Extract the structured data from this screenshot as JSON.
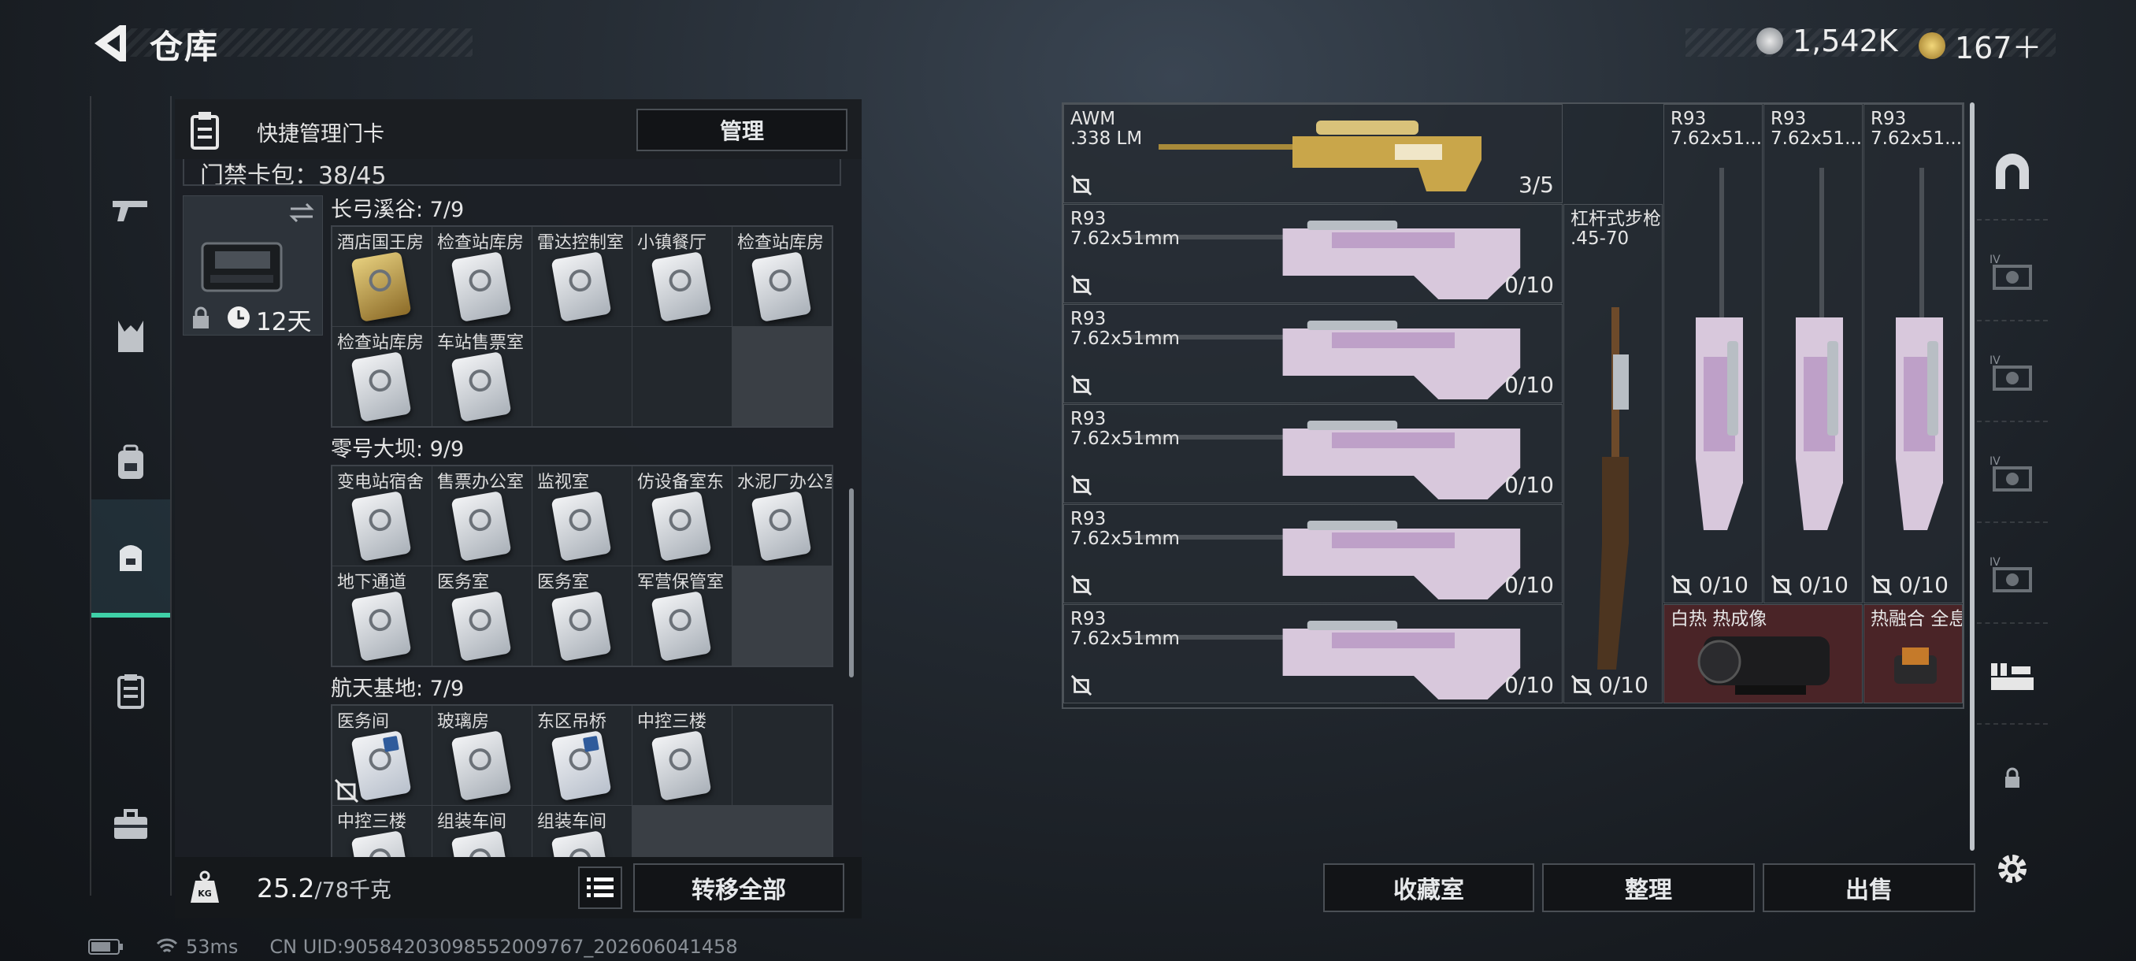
{
  "header": {
    "title": "仓库",
    "currency1": "1,542K",
    "currency2": "167＋"
  },
  "left_nav": [
    {
      "icon": "rifle-icon"
    },
    {
      "icon": "armor-icon"
    },
    {
      "icon": "backpack-icon"
    },
    {
      "icon": "bag-icon"
    },
    {
      "icon": "card-case-icon"
    },
    {
      "icon": "toolbox-icon"
    }
  ],
  "manager": {
    "title": "快捷管理门卡",
    "button": "管理",
    "pack_label": "门禁卡包：38/45",
    "bag_days": "12天"
  },
  "sections": [
    {
      "title": "长弓溪谷: 7/9",
      "cells": [
        {
          "label": "酒店国王房",
          "color": "red",
          "card": "gold"
        },
        {
          "label": "检查站库房",
          "color": "grey",
          "card": "white"
        },
        {
          "label": "雷达控制室",
          "color": "brown",
          "card": "white"
        },
        {
          "label": "小镇餐厅",
          "color": "purple",
          "card": "white"
        },
        {
          "label": "检查站库房",
          "color": "blue",
          "card": "white"
        },
        {
          "label": "检查站库房",
          "color": "grey",
          "card": "white"
        },
        {
          "label": "车站售票室",
          "color": "grey",
          "card": "white"
        },
        {
          "label": "",
          "color": "dark",
          "card": ""
        },
        {
          "label": "",
          "color": "dark",
          "card": ""
        }
      ]
    },
    {
      "title": "零号大坝: 9/9",
      "cells": [
        {
          "label": "变电站宿舍",
          "color": "grey",
          "card": "white"
        },
        {
          "label": "售票办公室",
          "color": "grey",
          "card": "white"
        },
        {
          "label": "监视室",
          "color": "brown",
          "card": "white"
        },
        {
          "label": "仿设备室东",
          "color": "brown",
          "card": "white"
        },
        {
          "label": "水泥厂办公室",
          "color": "purple",
          "card": "white"
        },
        {
          "label": "地下通道",
          "color": "blue",
          "card": "white"
        },
        {
          "label": "医务室",
          "color": "grey",
          "card": "white"
        },
        {
          "label": "医务室",
          "color": "grey",
          "card": "white"
        },
        {
          "label": "军营保管室",
          "color": "grey",
          "card": "white"
        }
      ]
    },
    {
      "title": "航天基地: 7/9",
      "cells": [
        {
          "label": "医务间",
          "color": "purple",
          "card": "blue"
        },
        {
          "label": "玻璃房",
          "color": "purple",
          "card": "white"
        },
        {
          "label": "东区吊桥",
          "color": "brown",
          "card": "blue"
        },
        {
          "label": "中控三楼",
          "color": "purple",
          "card": "white"
        },
        {
          "label": "",
          "color": "dark",
          "card": ""
        },
        {
          "label": "中控三楼",
          "color": "grey",
          "card": "white"
        },
        {
          "label": "组装车间",
          "color": "grey",
          "card": "white"
        },
        {
          "label": "组装车间",
          "color": "grey",
          "card": "white"
        }
      ]
    }
  ],
  "weight": {
    "current": "25.2",
    "max": "/78千克",
    "transfer": "转移全部"
  },
  "status": {
    "ping": "53ms",
    "uid": "CN UID:9058420309855200​9767_202606041458"
  },
  "weapons": [
    {
      "name": "AWM\n.338 LM",
      "count": "3/5"
    },
    {
      "name": "R93\n7.62x51mm",
      "count": "0/10"
    },
    {
      "name": "R93\n7.62x51mm",
      "count": "0/10"
    },
    {
      "name": "R93\n7.62x51mm",
      "count": "0/10"
    },
    {
      "name": "R93\n7.62x51mm",
      "count": "0/10"
    },
    {
      "name": "R93\n7.62x51mm",
      "count": "0/10"
    },
    {
      "name": "杠杆式步枪\n.45-70",
      "count": "0/10"
    },
    {
      "name": "R93\n7.62x51...",
      "count": "0/10"
    },
    {
      "name": "R93\n7.62x51...",
      "count": "0/10"
    },
    {
      "name": "R93\n7.62x51...",
      "count": "0/10"
    },
    {
      "name": "白热 热成像",
      "count": ""
    },
    {
      "name": "热融合 全息",
      "count": ""
    }
  ],
  "buttons": {
    "collection": "收藏室",
    "sort": "整理",
    "sell": "出售"
  },
  "right_nav": [
    {
      "icon": "arch-icon"
    },
    {
      "icon": "armor-attachment-icon",
      "tier": "IV"
    },
    {
      "icon": "armor-attachment-icon",
      "tier": "IV"
    },
    {
      "icon": "armor-attachment-icon",
      "tier": "IV"
    },
    {
      "icon": "armor-attachment-icon",
      "tier": "IV"
    },
    {
      "icon": "attachment-icon"
    },
    {
      "icon": "lock-icon"
    },
    {
      "icon": "gear-icon"
    }
  ]
}
